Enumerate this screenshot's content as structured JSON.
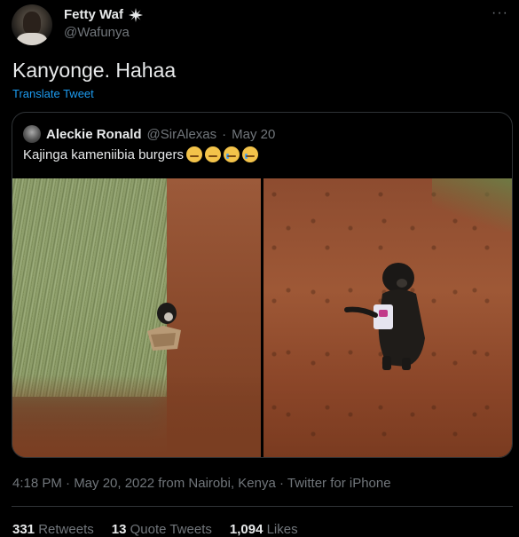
{
  "author": {
    "name": "Fetty Waf",
    "handle": "@Wafunya",
    "badge_icon": "sparkle-emoji-icon",
    "avatar_icon": "avatar-photo"
  },
  "more_icon": "more-dots-icon",
  "tweet": {
    "text": "Kanyonge. Hahaa",
    "translate_label": "Translate Tweet"
  },
  "quote": {
    "name": "Aleckie Ronald",
    "handle": "@SirAlexas",
    "separator": "·",
    "date": "May 20",
    "text": "Kajinga kameniibia burgers",
    "emojis": [
      "unamused-face-icon",
      "unamused-face-icon",
      "crying-face-icon",
      "crying-face-icon"
    ],
    "media": [
      {
        "name": "photo-monkey-in-grass"
      },
      {
        "name": "photo-monkey-holding-bag"
      }
    ]
  },
  "meta": {
    "text": "4:18 PM · May 20, 2022 from Nairobi, Kenya · Twitter for iPhone"
  },
  "stats": [
    {
      "count": "331",
      "label": "Retweets"
    },
    {
      "count": "13",
      "label": "Quote Tweets"
    },
    {
      "count": "1,094",
      "label": "Likes"
    }
  ],
  "colors": {
    "background": "#000000",
    "text": "#e7e9ea",
    "muted": "#71767b",
    "link": "#1d9bf0",
    "border": "#2f3336"
  }
}
